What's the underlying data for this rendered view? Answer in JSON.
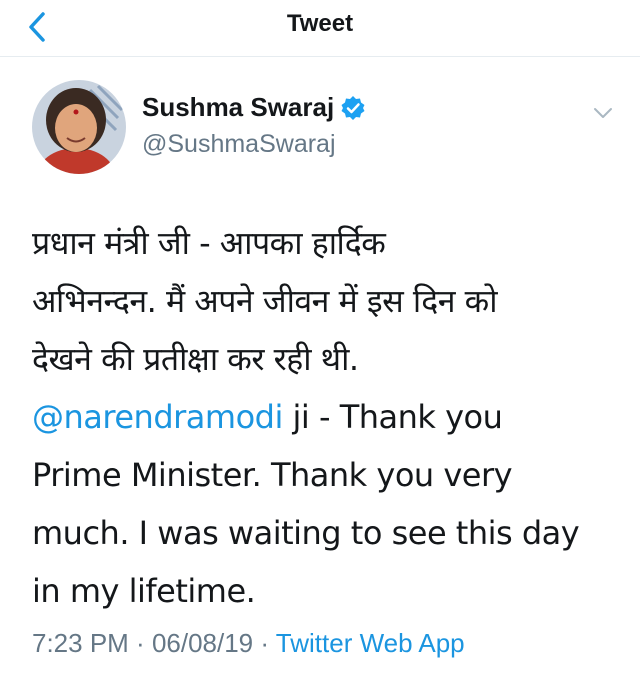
{
  "nav": {
    "title": "Tweet",
    "back_icon": "chevron-left-icon"
  },
  "colors": {
    "link": "#1b95e0",
    "secondary_text": "#657786",
    "primary_text": "#14171a",
    "verified_badge": "#1da1f2"
  },
  "author": {
    "name": "Sushma Swaraj",
    "handle": "@SushmaSwaraj",
    "verified": true
  },
  "tweet": {
    "lines": [
      "प्रधान मंत्री जी - आपका हार्दिक",
      "अभिनन्दन. मैं अपने जीवन में इस दिन को",
      "देखने की प्रतीक्षा कर रही थी."
    ],
    "mention": "@narendramodi",
    "english_lines": [
      " ji - Thank you",
      "Prime Minister. Thank you very",
      "much. I was waiting to see this day",
      "in my lifetime."
    ]
  },
  "meta": {
    "time": "7:23 PM",
    "separator1": " · ",
    "date": "06/08/19",
    "separator2": " · ",
    "source": "Twitter Web App"
  }
}
